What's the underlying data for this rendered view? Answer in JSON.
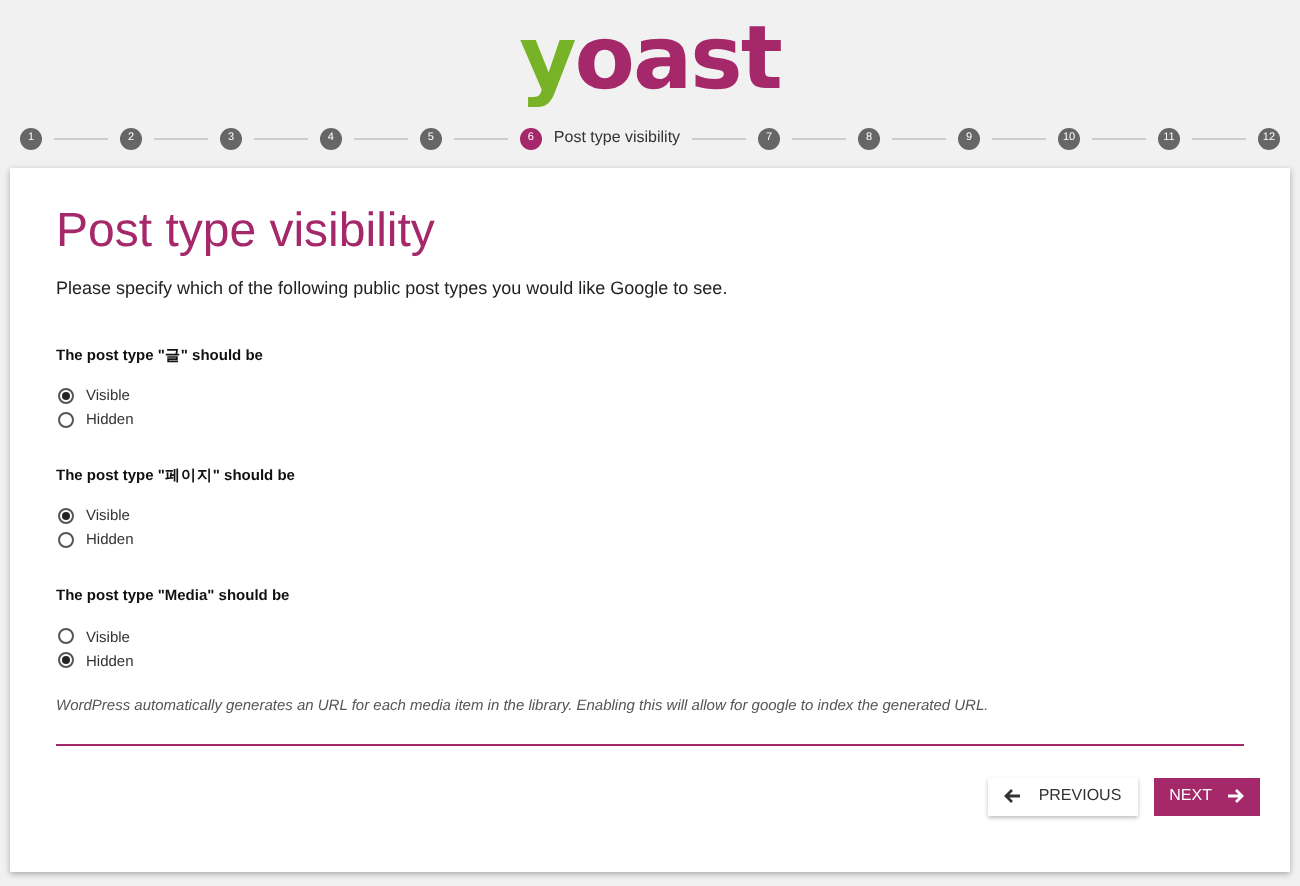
{
  "logo": [
    {
      "text": "y",
      "color": "#77b227"
    },
    {
      "text": "oast",
      "color": "#a4286a"
    }
  ],
  "steps": [
    {
      "number": "1",
      "selected": false
    },
    {
      "number": "2",
      "selected": false
    },
    {
      "number": "3",
      "selected": false
    },
    {
      "number": "4",
      "selected": false
    },
    {
      "number": "5",
      "selected": false
    },
    {
      "number": "6",
      "selected": true,
      "title": "Post type visibility"
    },
    {
      "number": "7",
      "selected": false
    },
    {
      "number": "8",
      "selected": false
    },
    {
      "number": "9",
      "selected": false
    },
    {
      "number": "10",
      "selected": false
    },
    {
      "number": "11",
      "selected": false
    },
    {
      "number": "12",
      "selected": false
    }
  ],
  "heading": "Post type visibility",
  "intro": "Please specify which of the following public post types you would like Google to see.",
  "groups": [
    {
      "question": "The post type \"글\" should be",
      "options": [
        {
          "label": "Visible",
          "selected": true
        },
        {
          "label": "Hidden",
          "selected": false
        }
      ]
    },
    {
      "question": "The post type \"페이지\" should be",
      "options": [
        {
          "label": "Visible",
          "selected": true
        },
        {
          "label": "Hidden",
          "selected": false
        }
      ]
    },
    {
      "question": "The post type \"Media\" should be",
      "options": [
        {
          "label": "Visible",
          "selected": false
        },
        {
          "label": "Hidden",
          "selected": true
        }
      ]
    }
  ],
  "note": "WordPress automatically generates an URL for each media item in the library. Enabling this will allow for google to index the generated URL.",
  "buttons": {
    "previous": "PREVIOUS",
    "next": "NEXT"
  }
}
